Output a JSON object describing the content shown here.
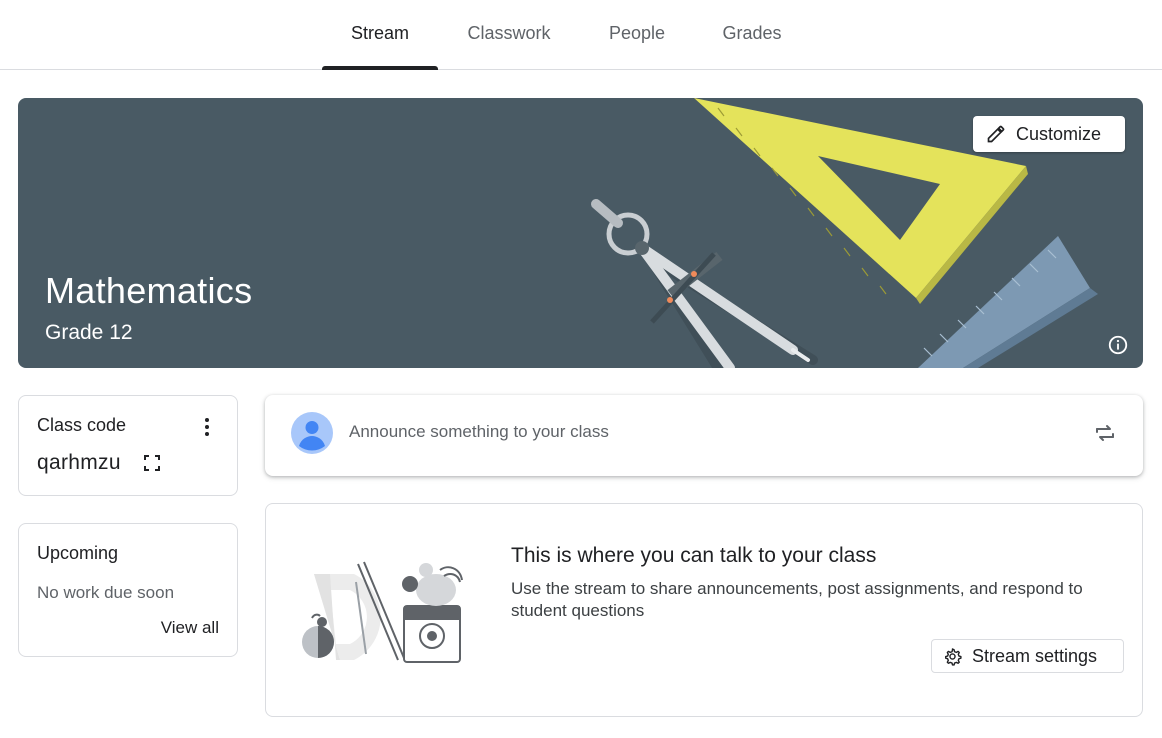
{
  "tabs": [
    {
      "label": "Stream",
      "active": true
    },
    {
      "label": "Classwork",
      "active": false
    },
    {
      "label": "People",
      "active": false
    },
    {
      "label": "Grades",
      "active": false
    }
  ],
  "banner": {
    "title": "Mathematics",
    "subtitle": "Grade 12",
    "customize_label": "Customize",
    "customize_icon": "pencil-icon",
    "info_icon": "info-icon",
    "background_color": "#495a64"
  },
  "class_code": {
    "label": "Class code",
    "value": "qarhmzu",
    "more_icon": "more-vert-icon",
    "expand_icon": "fullscreen-icon"
  },
  "upcoming": {
    "title": "Upcoming",
    "empty_text": "No work due soon",
    "view_all_label": "View all"
  },
  "announce": {
    "placeholder": "Announce something to your class",
    "avatar_icon": "avatar-icon",
    "repost_icon": "repost-icon"
  },
  "talk": {
    "title": "This is where you can talk to your class",
    "description": "Use the stream to share announcements, post assignments, and respond to student questions",
    "settings_label": "Stream settings",
    "settings_icon": "gear-icon"
  },
  "colors": {
    "text_primary": "#202124",
    "text_secondary": "#5f6368",
    "border": "#dadce0",
    "avatar_blue": "#4285f4"
  }
}
